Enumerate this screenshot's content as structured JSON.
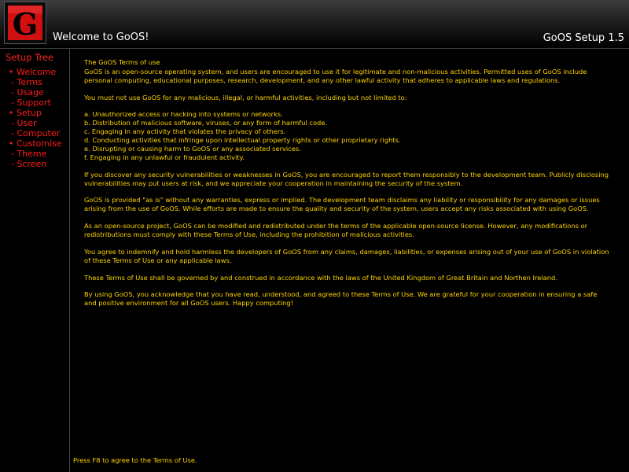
{
  "header": {
    "logo_letter": "G",
    "title": "Welcome to GoOS!",
    "version": "GoOS Setup 1.5"
  },
  "sidebar": {
    "title": "Setup Tree",
    "items": [
      {
        "label": "• Welcome",
        "level": 0
      },
      {
        "label": "- Terms",
        "level": 1
      },
      {
        "label": "- Usage",
        "level": 1
      },
      {
        "label": "- Support",
        "level": 1
      },
      {
        "label": "• Setup",
        "level": 0
      },
      {
        "label": "- User",
        "level": 1
      },
      {
        "label": "- Computer",
        "level": 1
      },
      {
        "label": "• Customise",
        "level": 0
      },
      {
        "label": "- Theme",
        "level": 1
      },
      {
        "label": "- Screen",
        "level": 1
      }
    ]
  },
  "content": {
    "title": "The GoOS Terms of use",
    "intro": "GoOS is an open-source operating system, and users are encouraged to use it for legitimate and non-malicious activities. Permitted uses of GoOS include personal computing, educational purposes, research, development, and any other lawful activity that adheres to applicable laws and regulations.",
    "prohibited_intro": "You must not use GoOS for any malicious, illegal, or harmful activities, including but not limited to:",
    "prohibited_list": [
      "a. Unauthorized access or hacking into systems or networks.",
      "b. Distribution of malicious software, viruses, or any form of harmful code.",
      "c. Engaging in any activity that violates the privacy of others.",
      "d. Conducting activities that infringe upon intellectual property rights or other proprietary rights.",
      "e. Disrupting or causing harm to GoOS or any associated services.",
      "f. Engaging in any unlawful or fraudulent activity."
    ],
    "security": "If you discover any security vulnerabilities or weaknesses in GoOS, you are encouraged to report them responsibly to the development team. Publicly disclosing vulnerabilities may put users at risk, and we appreciate your cooperation in maintaining the security of the system.",
    "warranty": "GoOS is provided \"as is\" without any warranties, express or implied. The development team disclaims any liability or responsibility for any damages or issues arising from the use of GoOS. While efforts are made to ensure the quality and security of the system, users accept any risks associated with using GoOS.",
    "license": "As an open-source project, GoOS can be modified and redistributed under the terms of the applicable open-source license. However, any modifications or redistributions must comply with these Terms of Use, including the prohibition of malicious activities.",
    "indemnify": "You agree to indemnify and hold harmless the developers of GoOS from any claims, damages, liabilities, or expenses arising out of your use of GoOS in violation of these Terms of Use or any applicable laws.",
    "governing_law": "These Terms of Use shall be governed by and construed in accordance with the laws of the United Kingdom of Great Britain and Northen Ireland.",
    "closing": "By using GoOS, you acknowledge that you have read, understood, and agreed to these Terms of Use. We are grateful for your cooperation in ensuring a safe and positive environment for all GoOS users. Happy computing!"
  },
  "footer": {
    "hint": "Press F8 to agree to the Terms of Use."
  },
  "colors": {
    "background": "#000000",
    "accent_red": "#ff1a1a",
    "text_yellow": "#ffd400",
    "header_text": "#ffffff"
  }
}
